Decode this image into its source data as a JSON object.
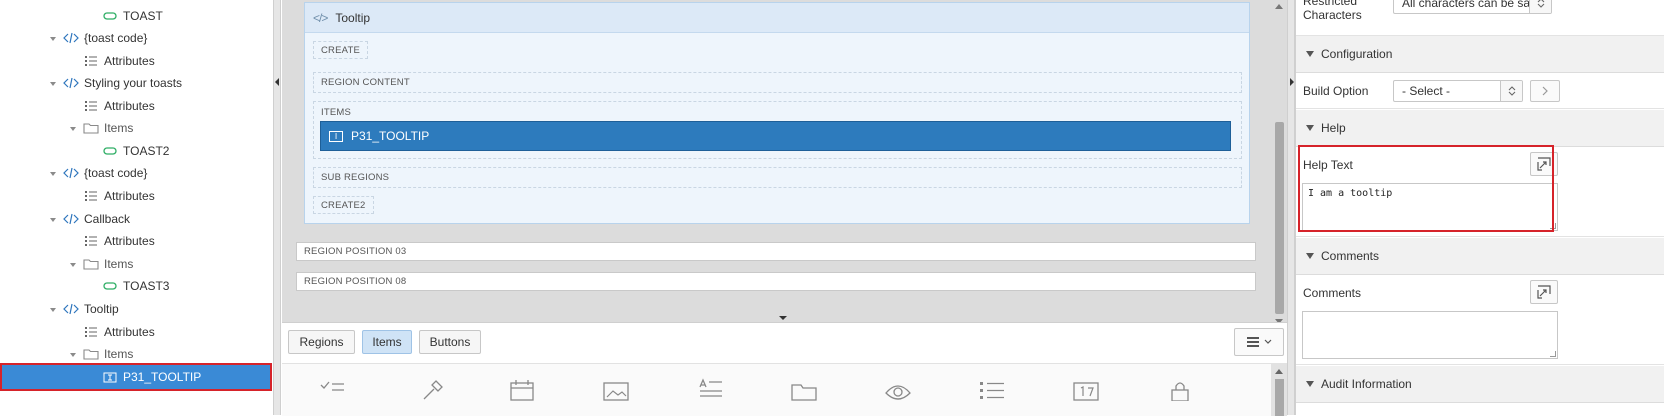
{
  "tree": {
    "nodes": [
      {
        "label": "TOAST",
        "icon": "button-icon"
      },
      {
        "label": "{toast code}",
        "icon": "code-icon"
      },
      {
        "label": "Attributes",
        "icon": "list-icon"
      },
      {
        "label": "Styling your toasts",
        "icon": "code-icon"
      },
      {
        "label": "Attributes",
        "icon": "list-icon"
      },
      {
        "label": "Items",
        "icon": "folder-icon"
      },
      {
        "label": "TOAST2",
        "icon": "button-icon"
      },
      {
        "label": "{toast code}",
        "icon": "code-icon"
      },
      {
        "label": "Attributes",
        "icon": "list-icon"
      },
      {
        "label": "Callback",
        "icon": "code-icon"
      },
      {
        "label": "Attributes",
        "icon": "list-icon"
      },
      {
        "label": "Items",
        "icon": "folder-icon"
      },
      {
        "label": "TOAST3",
        "icon": "button-icon"
      },
      {
        "label": "Tooltip",
        "icon": "code-icon"
      },
      {
        "label": "Attributes",
        "icon": "list-icon"
      },
      {
        "label": "Items",
        "icon": "folder-icon"
      },
      {
        "label": "P31_TOOLTIP",
        "icon": "textfield-icon",
        "selected": true
      }
    ]
  },
  "layout": {
    "region_title": "Tooltip",
    "positions": {
      "create": "CREATE",
      "region_content": "REGION CONTENT",
      "items": "ITEMS",
      "sub_regions": "SUB REGIONS",
      "create2": "CREATE2"
    },
    "item_label": "P31_TOOLTIP",
    "item_icon_glyph": "I",
    "region_pos_03": "REGION POSITION 03",
    "region_pos_08": "REGION POSITION 08"
  },
  "gallery": {
    "tabs": [
      "Regions",
      "Items",
      "Buttons"
    ],
    "active_tab": "Items",
    "icons": [
      "checkbox-list-icon",
      "color-picker-icon",
      "date-picker-icon",
      "image-icon",
      "text-area-icon",
      "folder-icon",
      "hidden-icon",
      "list-icon",
      "number-field-icon",
      "password-icon"
    ]
  },
  "props": {
    "restricted_label": "Restricted Characters",
    "restricted_value": "All characters can be sav",
    "configuration": "Configuration",
    "build_option_label": "Build Option",
    "build_option_value": "- Select -",
    "help": "Help",
    "help_text_label": "Help Text",
    "help_text_value": "I am a tooltip",
    "comments_section": "Comments",
    "comments_label": "Comments",
    "comments_value": "",
    "audit": "Audit Information"
  },
  "colors": {
    "accent": "#2d7bbd",
    "tree_selected": "#3a8ad6",
    "highlight": "#d6232a",
    "icon_blue": "#2f76bd",
    "icon_green": "#2eae65"
  }
}
